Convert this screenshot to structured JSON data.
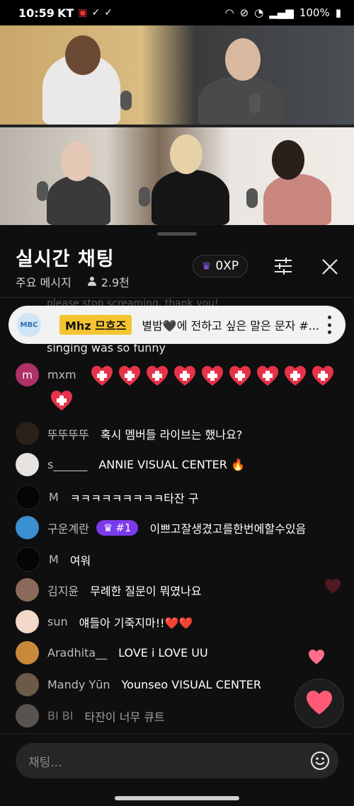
{
  "status_bar": {
    "time": "10:59",
    "carrier": "KT",
    "battery": "100%"
  },
  "chat": {
    "title": "실시간 채팅",
    "mode": "주요 메시지",
    "viewers": "2.9천",
    "xp_label": "0XP",
    "faded_message": "please stop screaming, thank you!",
    "pinned": {
      "avatar_text": "MBC",
      "badge": "Mhz 므흐즈",
      "text": "별밤🖤에 전하고 싶은 말은 문자 #..."
    },
    "continued_text": "singing was so funny",
    "messages": [
      {
        "name": "mxm",
        "text": "",
        "avatar_letter": "m",
        "avatar_color": "#b0306a"
      },
      {
        "name": "뚜뚜뚜뚜",
        "text": "혹시 멤버들 라이브는 했나요?",
        "avatar_letter": "",
        "avatar_color": "#2b2118"
      },
      {
        "name": "s______",
        "text": "ANNIE VISUAL CENTER 🔥",
        "avatar_letter": "",
        "avatar_color": "#e8e3df"
      },
      {
        "name": "M",
        "text": "ㅋㅋㅋㅋㅋㅋㅋㅋㅋ타잔 구",
        "avatar_letter": "",
        "avatar_color": "#050505"
      },
      {
        "name": "구운계란",
        "text": "이쁘고잘생겼고를한번에할수있음",
        "avatar_letter": "",
        "avatar_color": "#3a8fd0",
        "chip": "#1"
      },
      {
        "name": "M",
        "text": "여워",
        "avatar_letter": "",
        "avatar_color": "#050505"
      },
      {
        "name": "김지윤",
        "text": "무례한 질문이 뭐였나요",
        "avatar_letter": "",
        "avatar_color": "#8a6a5a"
      },
      {
        "name": "sun",
        "text": "얘들아 기죽지마!!❤️❤️",
        "avatar_letter": "",
        "avatar_color": "#f1d8c8"
      },
      {
        "name": "Aradhita__",
        "text": "LOVE i LOVE UU",
        "avatar_letter": "",
        "avatar_color": "#c88a3a"
      },
      {
        "name": "Mandy Yūn",
        "text": "Younseo VISUAL CENTER",
        "avatar_letter": "",
        "avatar_color": "#6b5a48"
      },
      {
        "name": "BI BI",
        "text": "타잔이 너무 큐트",
        "avatar_letter": "",
        "avatar_color": "#8a8178"
      }
    ],
    "input_placeholder": "채팅..."
  },
  "colors": {
    "accent_purple": "#7c3aed",
    "badge_yellow": "#f4c430",
    "heart_red": "#e6334a"
  }
}
